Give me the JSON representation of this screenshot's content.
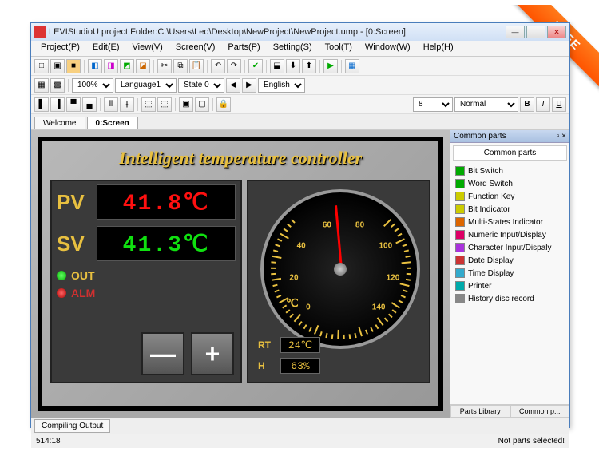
{
  "ribbon": "FREE",
  "window": {
    "title": "LEVIStudioU   project Folder:C:\\Users\\Leo\\Desktop\\NewProject\\NewProject.ump  - [0:Screen]"
  },
  "menu": [
    "Project(P)",
    "Edit(E)",
    "View(V)",
    "Screen(V)",
    "Parts(P)",
    "Setting(S)",
    "Tool(T)",
    "Window(W)",
    "Help(H)"
  ],
  "toolbar2": {
    "zoom": "100%",
    "language": "Language1",
    "state": "State 0",
    "lang2": "English"
  },
  "toolbar3": {
    "fontsize": "8",
    "style": "Normal"
  },
  "tabs": {
    "items": [
      "Welcome",
      "0:Screen"
    ],
    "active": 1
  },
  "hmi": {
    "title": "Intelligent temperature controller",
    "pv_label": "PV",
    "pv_value": "41.8℃",
    "sv_label": "SV",
    "sv_value": "41.3℃",
    "out_label": "OUT",
    "alm_label": "ALM",
    "minus": "—",
    "plus": "+",
    "unit": "℃",
    "rt_label": "RT",
    "rt_value": "24℃",
    "h_label": "H",
    "h_value": "63%",
    "gauge_marks": [
      "0",
      "20",
      "40",
      "60",
      "80",
      "100",
      "120",
      "140"
    ]
  },
  "side": {
    "panel_title": "Common parts",
    "header": "Common parts",
    "parts": [
      "Bit Switch",
      "Word Switch",
      "Function Key",
      "Bit Indicator",
      "Multi-States Indicator",
      "Numeric Input/Display",
      "Character Input/Dispaly",
      "Date Display",
      "Time Display",
      "Printer",
      "History disc record"
    ],
    "tabs": [
      "Parts Library",
      "Common p..."
    ]
  },
  "bottom_tab": "Compiling Output",
  "status": {
    "left": "514:18",
    "right": "Not parts selected!"
  }
}
